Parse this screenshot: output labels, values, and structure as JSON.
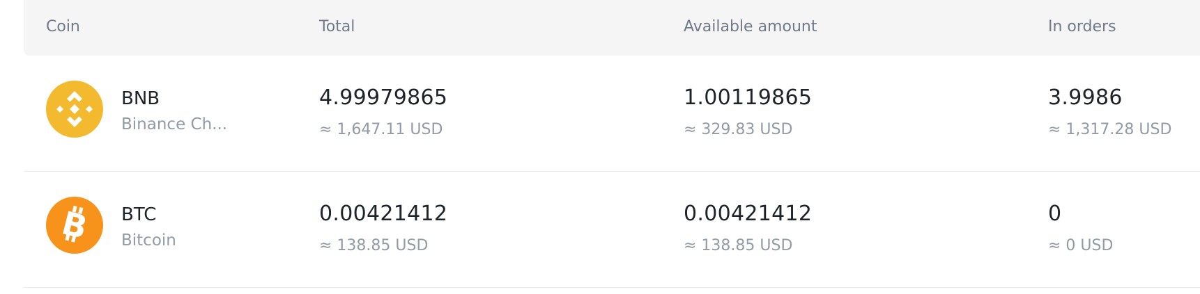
{
  "header": {
    "coin": "Coin",
    "total": "Total",
    "available": "Available amount",
    "in_orders": "In orders"
  },
  "rows": [
    {
      "icon": "bnb-icon",
      "icon_color": "#f3ba2f",
      "symbol": "BNB",
      "name": "Binance Ch...",
      "total": "4.99979865",
      "total_usd": "≈ 1,647.11 USD",
      "available": "1.00119865",
      "available_usd": "≈ 329.83 USD",
      "in_orders": "3.9986",
      "in_orders_usd": "≈ 1,317.28 USD"
    },
    {
      "icon": "btc-icon",
      "icon_color": "#f7931a",
      "symbol": "BTC",
      "name": "Bitcoin",
      "total": "0.00421412",
      "total_usd": "≈ 138.85 USD",
      "available": "0.00421412",
      "available_usd": "≈ 138.85 USD",
      "in_orders": "0",
      "in_orders_usd": "≈ 0 USD"
    }
  ]
}
